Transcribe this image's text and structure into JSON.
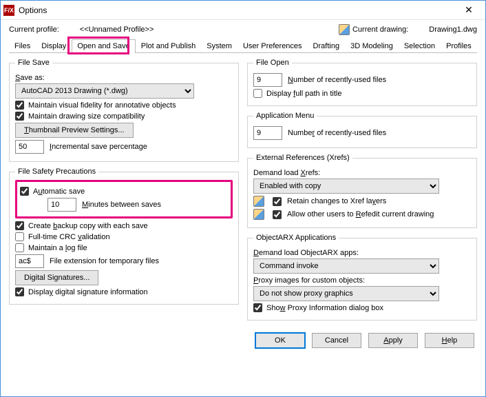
{
  "window": {
    "title": "Options"
  },
  "profile": {
    "label": "Current profile:",
    "name": "<<Unnamed Profile>>",
    "drawing_label": "Current drawing:",
    "drawing_name": "Drawing1.dwg"
  },
  "tabs": {
    "files": "Files",
    "display": "Display",
    "open_save": "Open and Save",
    "plot": "Plot and Publish",
    "system": "System",
    "user_prefs": "User Preferences",
    "drafting": "Drafting",
    "modeling": "3D Modeling",
    "selection": "Selection",
    "profiles": "Profiles"
  },
  "file_save": {
    "legend": "File Save",
    "save_as_label": "Save as:",
    "save_as_value": "AutoCAD 2013 Drawing (*.dwg)",
    "maintain_fidelity": "Maintain visual fidelity for annotative objects",
    "maintain_size": "Maintain drawing size compatibility",
    "thumbnail_btn": "Thumbnail Preview Settings...",
    "incremental_value": "50",
    "incremental_label": "Incremental save percentage"
  },
  "file_safety": {
    "legend": "File Safety Precautions",
    "auto_save": "Automatic save",
    "minutes_value": "10",
    "minutes_label": "Minutes between saves",
    "backup": "Create backup copy with each save",
    "crc": "Full-time CRC validation",
    "log": "Maintain a log file",
    "ext_value": "ac$",
    "ext_label": "File extension for temporary files",
    "sig_btn": "Digital Signatures...",
    "display_sig": "Display digital signature information"
  },
  "file_open": {
    "legend": "File Open",
    "recent_value": "9",
    "recent_label": "Number of recently-used files",
    "full_path": "Display full path in title"
  },
  "app_menu": {
    "legend": "Application Menu",
    "recent_value": "9",
    "recent_label": "Number of recently-used files"
  },
  "xrefs": {
    "legend": "External References (Xrefs)",
    "demand_label": "Demand load Xrefs:",
    "demand_value": "Enabled with copy",
    "retain": "Retain changes to Xref layers",
    "allow_refedit": "Allow other users to Refedit current drawing"
  },
  "arx": {
    "legend": "ObjectARX Applications",
    "demand_label": "Demand load ObjectARX apps:",
    "demand_value": "Command invoke",
    "proxy_label": "Proxy images for custom objects:",
    "proxy_value": "Do not show proxy graphics",
    "show_proxy": "Show Proxy Information dialog box"
  },
  "footer": {
    "ok": "OK",
    "cancel": "Cancel",
    "apply": "Apply",
    "help": "Help"
  }
}
